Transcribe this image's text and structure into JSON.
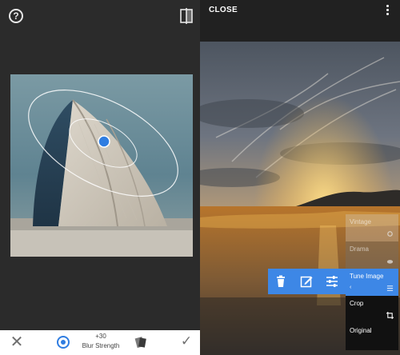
{
  "left_panel": {
    "help_icon": "question-circle-icon",
    "compare_icon": "compare-split-icon",
    "bottom_bar": {
      "cancel_icon": "close-icon",
      "target_icon": "focus-target-icon",
      "blur_value": "+30",
      "blur_label": "Blur Strength",
      "style_icon": "style-shapes-icon",
      "apply_icon": "check-icon"
    }
  },
  "right_panel": {
    "close_label": "CLOSE",
    "overflow_icon": "more-vertical-icon",
    "action_bar": {
      "icons": [
        "trash-icon",
        "edit-icon",
        "sliders-icon"
      ]
    },
    "menu": [
      {
        "label": "Vintage",
        "icon": "gear-icon"
      },
      {
        "label": "Drama",
        "icon": "cloud-icon"
      },
      {
        "label": "Tune Image",
        "sub": "‹",
        "icon": "tune-icon"
      },
      {
        "label": "Crop",
        "icon": "crop-icon"
      },
      {
        "label": "Original",
        "icon": ""
      }
    ]
  },
  "colors": {
    "accent": "#3d87e6",
    "dark_bg": "#2b2b2b",
    "menu_bg": "#111111"
  }
}
